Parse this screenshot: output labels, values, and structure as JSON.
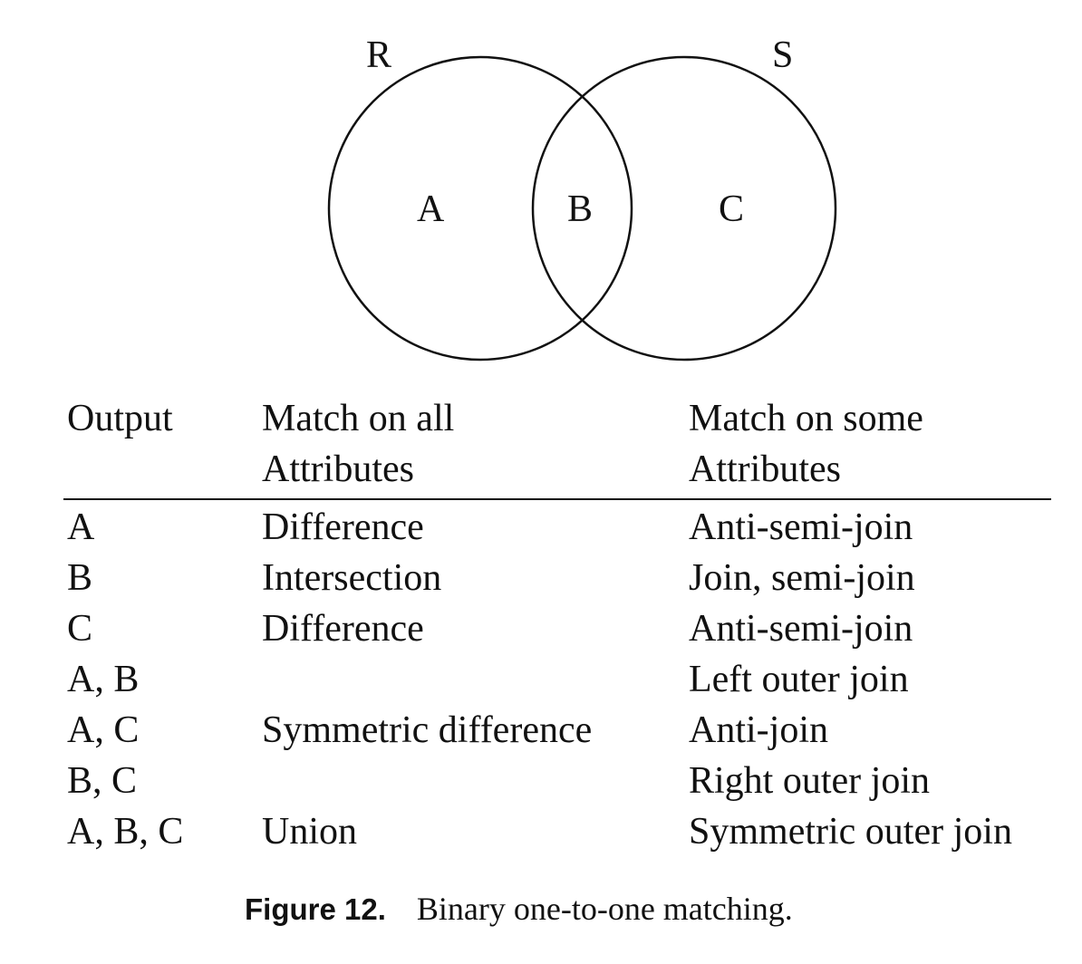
{
  "venn": {
    "set_left_label": "R",
    "set_right_label": "S",
    "region_left_label": "A",
    "region_middle_label": "B",
    "region_right_label": "C"
  },
  "table": {
    "headers": {
      "output": "Output",
      "all_line1": "Match on all",
      "all_line2": "Attributes",
      "some_line1": "Match on some",
      "some_line2": "Attributes"
    },
    "rows": [
      {
        "output": "A",
        "all": "Difference",
        "some": "Anti-semi-join"
      },
      {
        "output": "B",
        "all": "Intersection",
        "some": "Join, semi-join"
      },
      {
        "output": "C",
        "all": "Difference",
        "some": "Anti-semi-join"
      },
      {
        "output": "A, B",
        "all": "",
        "some": "Left outer join"
      },
      {
        "output": "A, C",
        "all": "Symmetric difference",
        "some": "Anti-join"
      },
      {
        "output": "B, C",
        "all": "",
        "some": "Right outer join"
      },
      {
        "output": "A, B, C",
        "all": "Union",
        "some": "Symmetric outer join"
      }
    ]
  },
  "caption": {
    "label": "Figure 12.",
    "text": "Binary one-to-one matching."
  }
}
